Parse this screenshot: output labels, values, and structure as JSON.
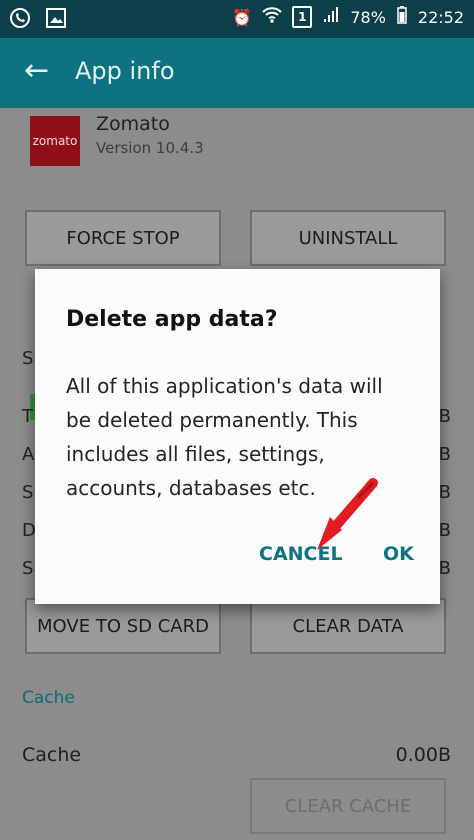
{
  "status_bar": {
    "battery_percent": "78%",
    "time": "22:52",
    "sim_slot": "1",
    "icons": [
      "whatsapp-icon",
      "image-icon",
      "alarm-icon",
      "wifi-icon",
      "signal-icon",
      "battery-icon"
    ]
  },
  "app_bar": {
    "title": "App info",
    "back_icon": "back-arrow-icon"
  },
  "app": {
    "icon_text": "zomato",
    "name": "Zomato",
    "version": "Version 10.4.3"
  },
  "buttons": {
    "force_stop": "FORCE STOP",
    "uninstall": "UNINSTALL",
    "move_to_sd": "MOVE TO SD CARD",
    "clear_data": "CLEAR DATA",
    "clear_cache": "CLEAR CACHE"
  },
  "obscured": {
    "left": [
      "S",
      "T",
      "A",
      "S",
      "D",
      "S"
    ],
    "right": [
      "B",
      "B",
      "B",
      "B",
      "B"
    ]
  },
  "cache": {
    "section": "Cache",
    "label": "Cache",
    "value": "0.00B"
  },
  "dialog": {
    "title": "Delete app data?",
    "message": "All of this application's data will be deleted permanently. This includes all files, settings, accounts, databases etc.",
    "cancel": "CANCEL",
    "ok": "OK"
  },
  "colors": {
    "status_bar": "#0c3f49",
    "app_bar": "#0f7281",
    "accent": "#0f7281",
    "annotation_arrow": "#e31b23"
  }
}
